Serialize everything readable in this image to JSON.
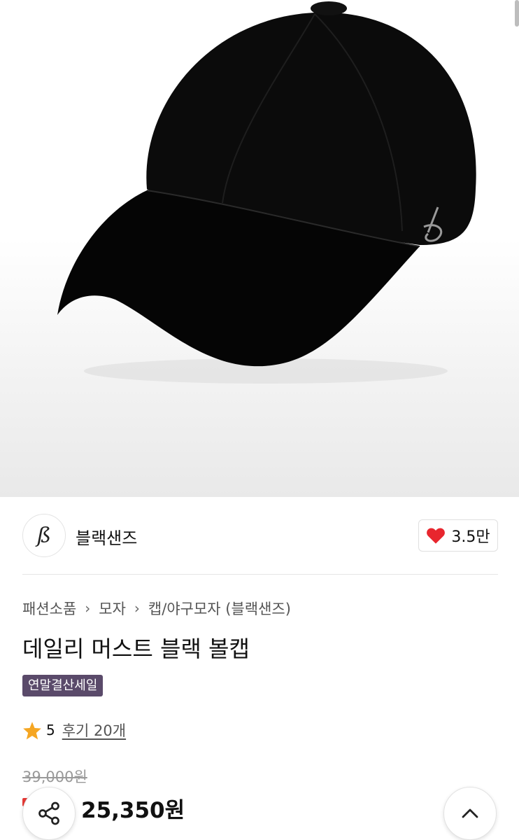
{
  "brand": {
    "logo_glyph": "ß",
    "name": "블랙샌즈"
  },
  "like": {
    "count": "3.5만",
    "icon": "heart-icon",
    "color": "#e8262e"
  },
  "breadcrumb": [
    "패션소품",
    "모자",
    "캡/야구모자 (블랙샌즈)"
  ],
  "product": {
    "title": "데일리 머스트 블랙 볼캡",
    "badge": "연말결산세일",
    "rating": "5",
    "reviews": "후기 20개",
    "original_price": "39,000원",
    "sale_price": "25,350원"
  },
  "buttons": {
    "share_icon": "share-icon",
    "top_icon": "chevron-up-icon"
  },
  "colors": {
    "badge_bg": "#5a4a6a",
    "star": "#f5a623"
  }
}
